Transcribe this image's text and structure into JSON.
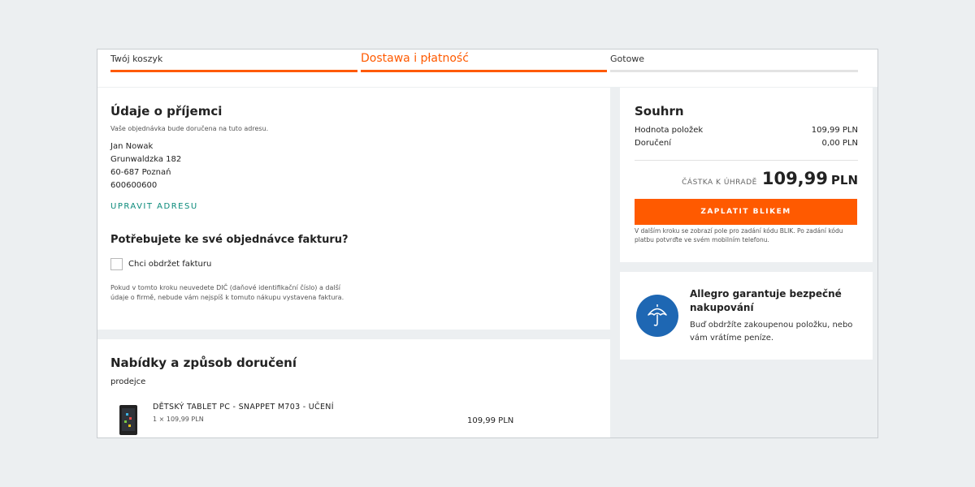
{
  "steps": [
    {
      "label": "Twój koszyk"
    },
    {
      "label": "Dostawa i płatność"
    },
    {
      "label": "Gotowe"
    }
  ],
  "recipient": {
    "title": "Údaje o příjemci",
    "note": "Vaše objednávka bude doručena na tuto adresu.",
    "name": "Jan Nowak",
    "street": "Grunwaldzka 182",
    "city": "60-687 Poznań",
    "phone": "600600600",
    "edit_label": "UPRAVIT ADRESU"
  },
  "invoice": {
    "title": "Potřebujete ke své objednávce fakturu?",
    "checkbox_label": "Chci obdržet fakturu",
    "checked": false,
    "note": "Pokud v tomto kroku neuvedete DIČ (daňové identifikační číslo) a další údaje o firmě, nebude vám nejspíš k tomuto nákupu vystavena faktura."
  },
  "delivery": {
    "title": "Nabídky a způsob doručení",
    "seller": "prodejce",
    "item_name": "DĚTSKÝ TABLET PC - SNAPPET M703 - UČENÍ",
    "item_qty": "1 × 109,99 PLN",
    "item_total": "109,99 PLN"
  },
  "summary": {
    "title": "Souhrn",
    "items_label": "Hodnota položek",
    "items_value": "109,99 PLN",
    "shipping_label": "Doručení",
    "shipping_value": "0,00 PLN",
    "due_label": "ČÁSTKA K ÚHRADĚ",
    "due_amount": "109,99",
    "due_currency": "PLN",
    "pay_button": "ZAPLATIT BLIKEM",
    "pay_note": "V dalším kroku se zobrazí pole pro zadání kódu BLIK. Po zadání kódu platbu potvrďte ve svém mobilním telefonu."
  },
  "guarantee": {
    "title": "Allegro garantuje bezpečné nakupování",
    "text": "Buď obdržíte zakoupenou položku, nebo vám vrátíme peníze.",
    "icon": "umbrella-icon"
  },
  "colors": {
    "accent": "#ff5a00",
    "link": "#0a8a7a",
    "guarantee_blue": "#1e67b3"
  }
}
